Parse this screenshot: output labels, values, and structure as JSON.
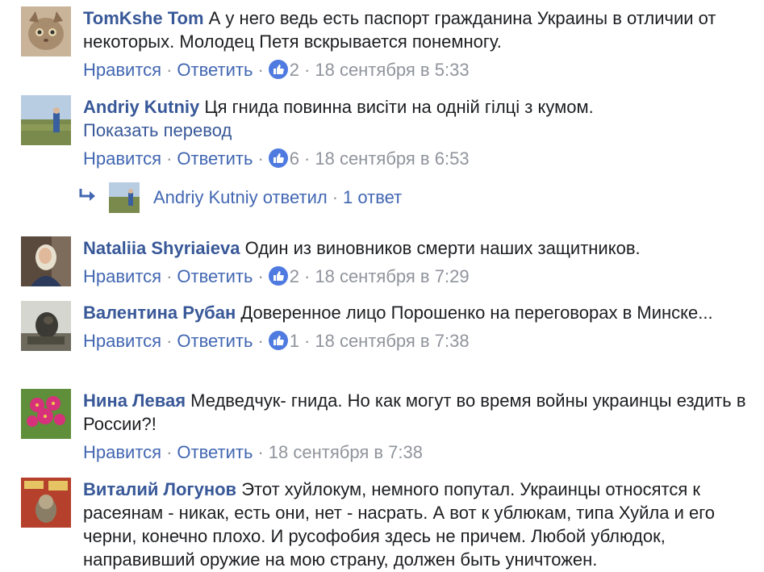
{
  "actions": {
    "like": "Нравится",
    "reply": "Ответить",
    "sep": "·"
  },
  "comments": [
    {
      "author": "TomKshe Tom",
      "text": " А у него ведь есть паспорт гражданина Украины в отличии от некоторых. Молодец Петя вскрывается понемногу.",
      "likes": "2",
      "time": "18 сентября в 5:33"
    },
    {
      "author": "Andriy Kutniy",
      "text": " Ця гнида повинна висіти на одній гілці з кумом.",
      "translate": "Показать перевод",
      "likes": "6",
      "time": "18 сентября в 6:53"
    },
    {
      "author": "Nataliia Shyriaieva",
      "text": " Один из виновников смерти наших защитников.",
      "likes": "2",
      "time": "18 сентября в 7:29"
    },
    {
      "author": "Валентина Рубан",
      "text": " Доверенное лицо Порошенко на переговорах в Минске...",
      "likes": "1",
      "time": "18 сентября в 7:38"
    },
    {
      "author": "Нина Левая",
      "text": " Медведчук- гнида. Но как могут во время войны украинцы ездить в России?!",
      "time": "18 сентября в 7:38"
    },
    {
      "author": "Виталий Логунов",
      "text": " Этот хуйлокум, немного попутал. Украинцы относятся к расеянам - никак, есть они, нет - насрать. А вот к ублюкам, типа Хуйла и его черни, конечно плохо. И русофобия здесь не причем. Любой ублюдок, направивший оружие на мою страну, должен быть уничтожен."
    }
  ],
  "reply_summary": {
    "name": "Andriy Kutniy ответил",
    "sep": "·",
    "count": "1 ответ"
  }
}
